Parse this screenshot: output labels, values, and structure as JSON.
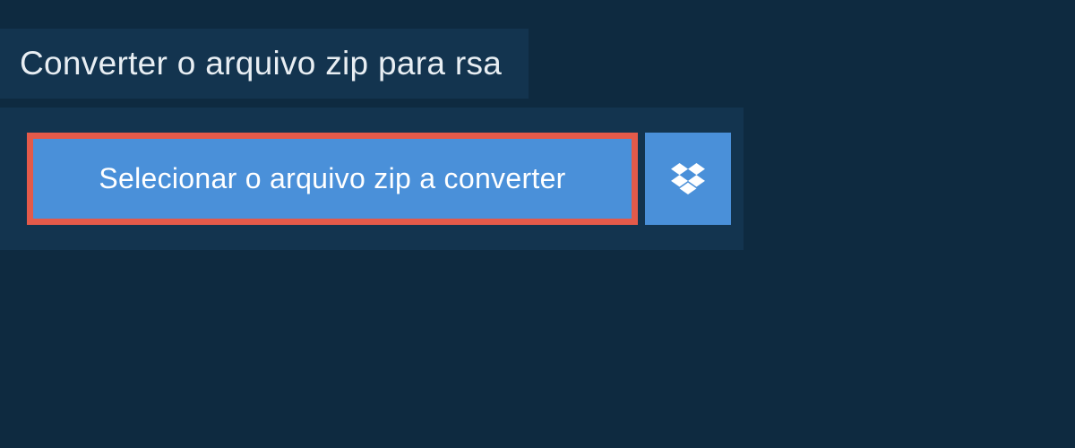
{
  "header": {
    "title": "Converter o arquivo zip para rsa"
  },
  "main": {
    "select_button_label": "Selecionar o arquivo zip a converter"
  },
  "icons": {
    "dropbox": "dropbox-icon"
  },
  "colors": {
    "page_bg": "#0e2a40",
    "panel_bg": "#13344f",
    "button_bg": "#4a90d9",
    "highlight_border": "#e45a4a",
    "text_light": "#e8eef3",
    "text_white": "#ffffff"
  }
}
